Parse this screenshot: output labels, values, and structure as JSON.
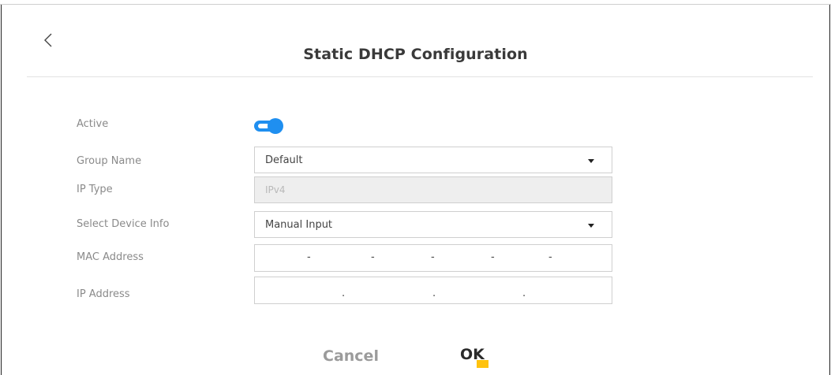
{
  "dialog": {
    "title": "Static DHCP Configuration"
  },
  "form": {
    "active_label": "Active",
    "active_on": true,
    "group_name_label": "Group Name",
    "group_name_value": "Default",
    "ip_type_label": "IP Type",
    "ip_type_value": "IPv4",
    "select_device_info_label": "Select Device Info",
    "select_device_info_value": "Manual Input",
    "mac_address_label": "MAC Address",
    "mac_separator": "-",
    "ip_address_label": "IP Address",
    "ip_separator": "."
  },
  "actions": {
    "cancel_label": "Cancel",
    "ok_label": "OK"
  },
  "colors": {
    "toggle_on": "#1f8ff0",
    "ok_accent": "#ffc20e"
  },
  "icons": {
    "back": "chevron-left-icon",
    "dropdown": "caret-down-icon"
  }
}
